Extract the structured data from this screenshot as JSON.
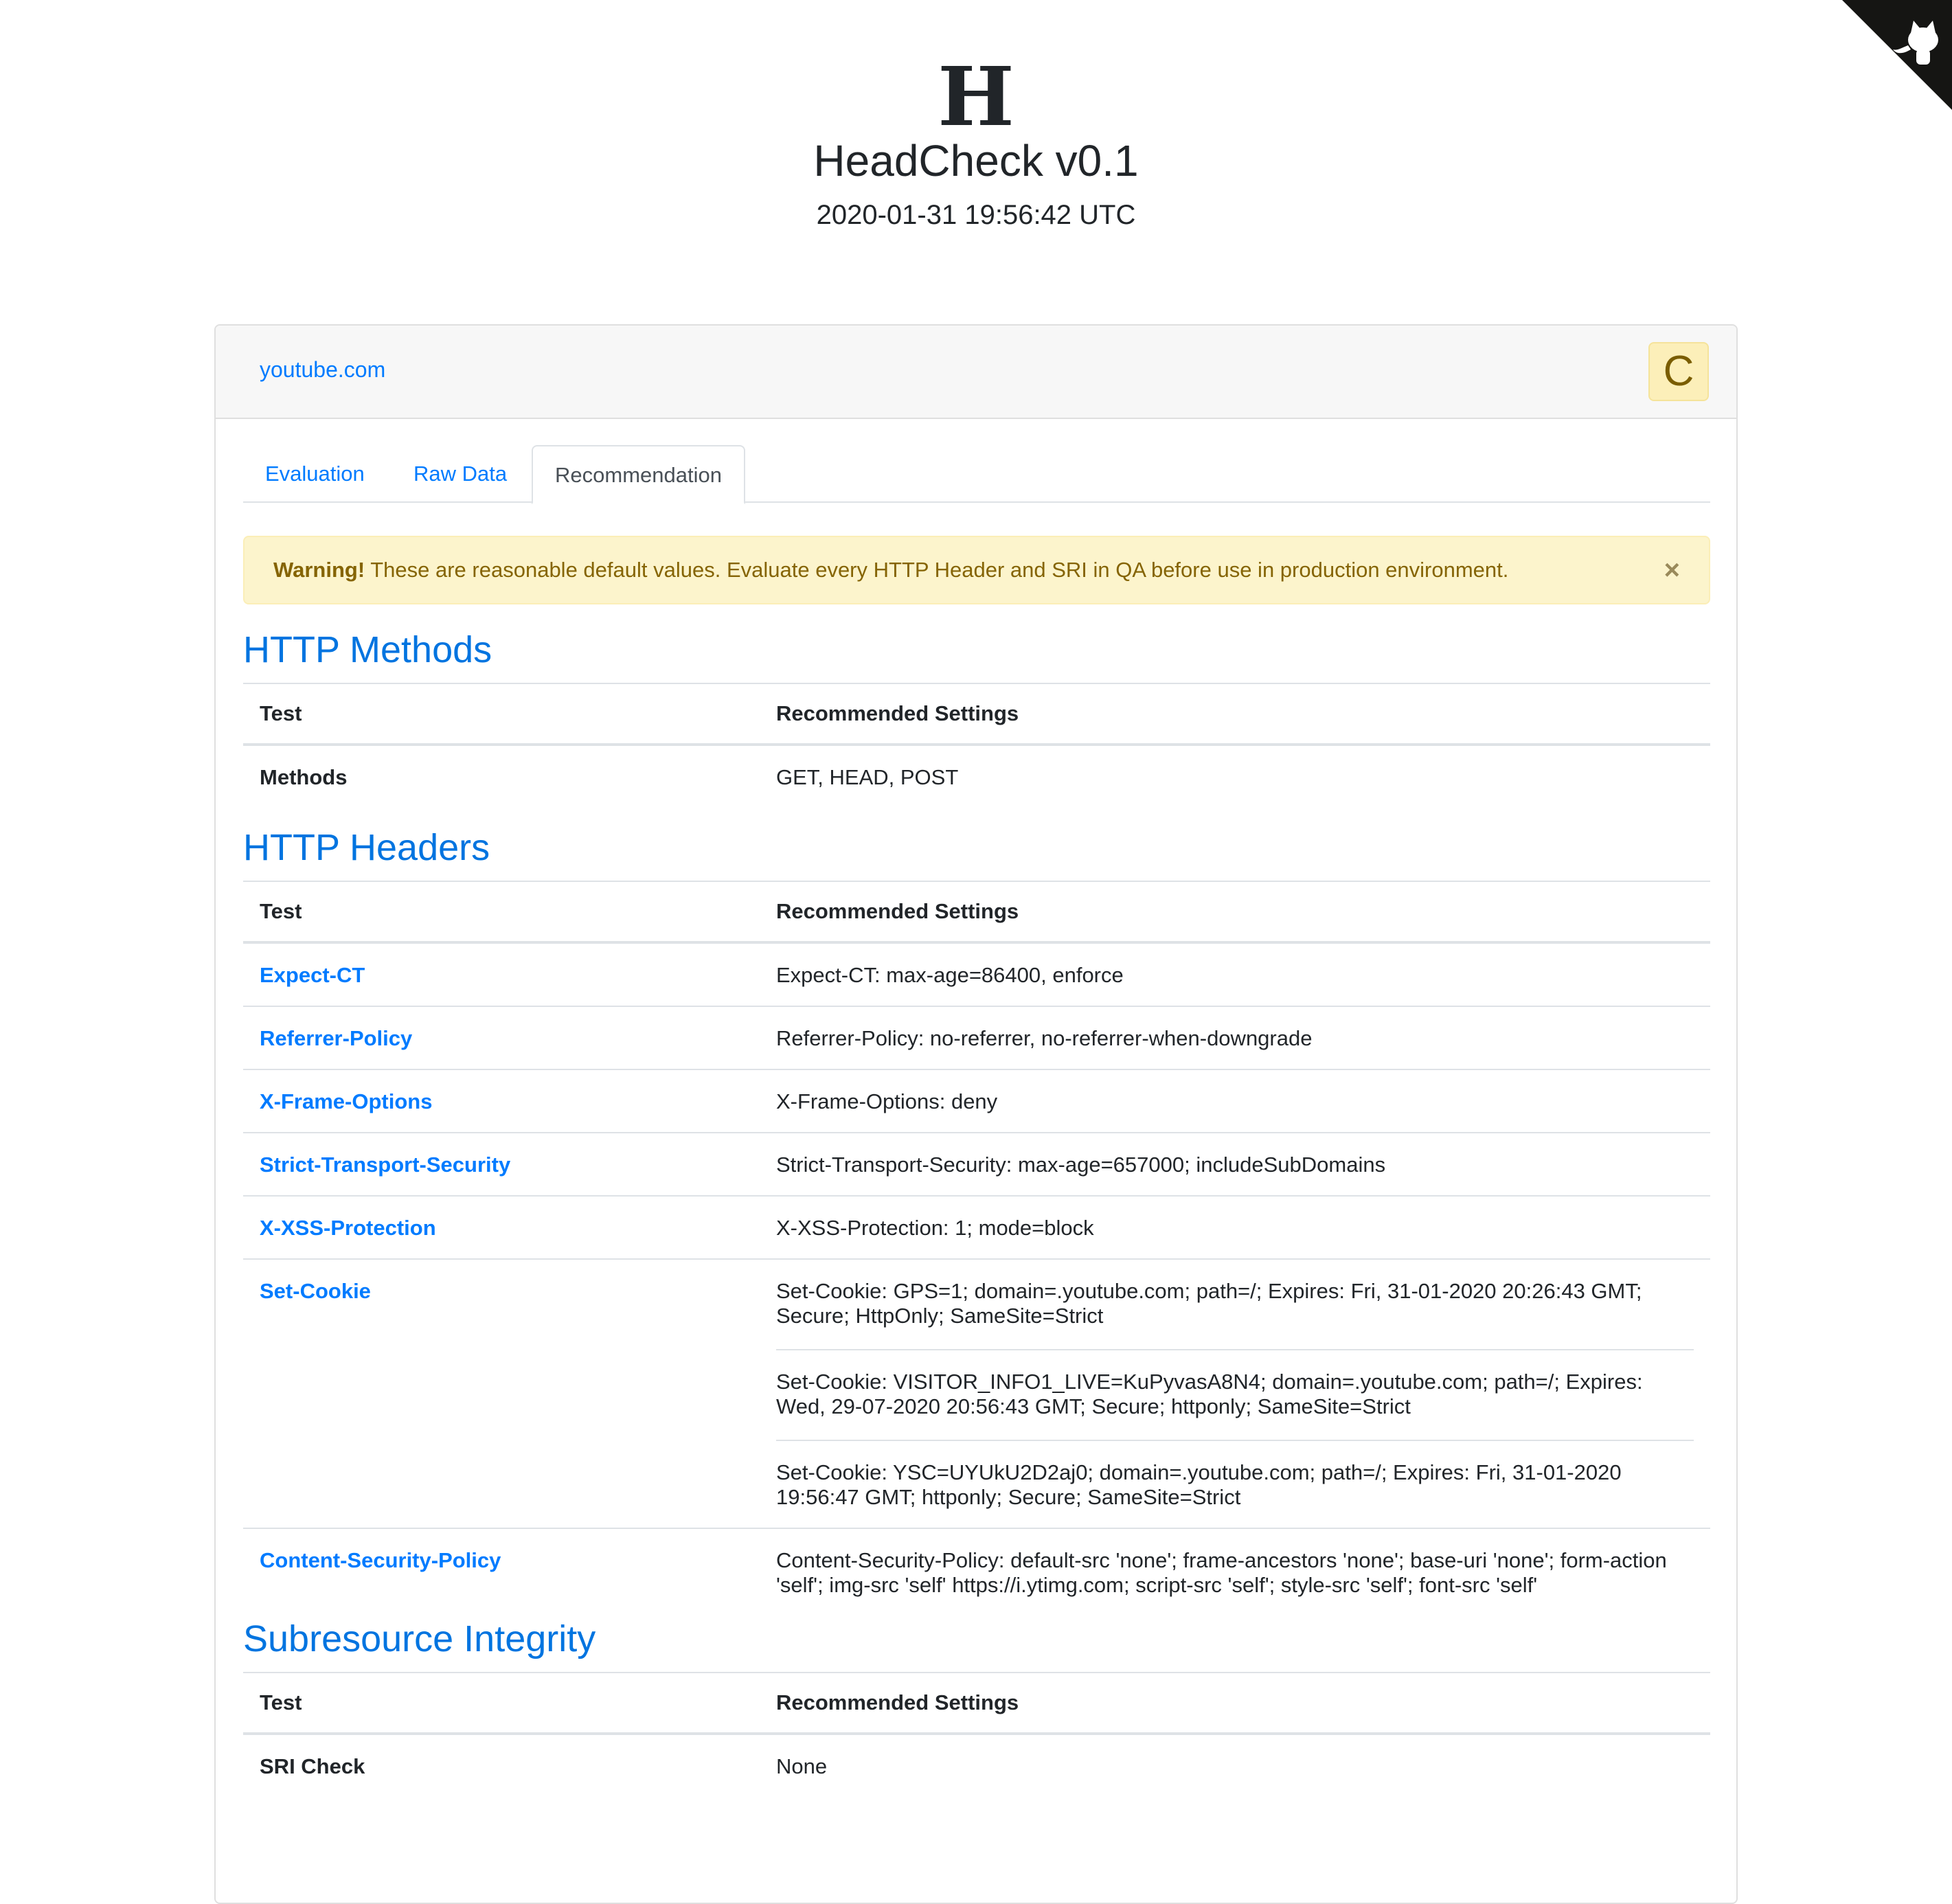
{
  "header": {
    "logo": "H",
    "app_title": "HeadCheck v0.1",
    "timestamp": "2020-01-31 19:56:42 UTC"
  },
  "corner_icon": "github-octocat-icon",
  "card": {
    "domain": "youtube.com",
    "grade": "C",
    "grade_color": "#7a5d00",
    "tabs": [
      {
        "label": "Evaluation",
        "active": false
      },
      {
        "label": "Raw Data",
        "active": false
      },
      {
        "label": "Recommendation",
        "active": true
      }
    ],
    "alert": {
      "strong": "Warning!",
      "text": " These are reasonable default values. Evaluate every HTTP Header and SRI in QA before use in production environment.",
      "close": "×"
    }
  },
  "colors": {
    "accent": "#007bff",
    "warning_bg": "#fcf4cc",
    "warning_text": "#856404"
  },
  "sections": {
    "methods": {
      "title": "HTTP Methods",
      "headers": [
        "Test",
        "Recommended Settings"
      ],
      "rows": [
        {
          "test": "Methods",
          "value": "GET, HEAD, POST"
        }
      ]
    },
    "headers": {
      "title": "HTTP Headers",
      "headers": [
        "Test",
        "Recommended Settings"
      ],
      "rows": [
        {
          "test": "Expect-CT",
          "value": "Expect-CT: max-age=86400, enforce"
        },
        {
          "test": "Referrer-Policy",
          "value": "Referrer-Policy: no-referrer, no-referrer-when-downgrade"
        },
        {
          "test": "X-Frame-Options",
          "value": "X-Frame-Options: deny"
        },
        {
          "test": "Strict-Transport-Security",
          "value": "Strict-Transport-Security: max-age=657000; includeSubDomains"
        },
        {
          "test": "X-XSS-Protection",
          "value": "X-XSS-Protection: 1; mode=block"
        },
        {
          "test": "Set-Cookie",
          "values": [
            "Set-Cookie: GPS=1; domain=.youtube.com; path=/; Expires: Fri, 31-01-2020 20:26:43 GMT; Secure; HttpOnly; SameSite=Strict",
            "Set-Cookie: VISITOR_INFO1_LIVE=KuPyvasA8N4; domain=.youtube.com; path=/; Expires: Wed, 29-07-2020 20:56:43 GMT; Secure; httponly; SameSite=Strict",
            "Set-Cookie: YSC=UYUkU2D2aj0; domain=.youtube.com; path=/; Expires: Fri, 31-01-2020 19:56:47 GMT; httponly; Secure; SameSite=Strict"
          ]
        },
        {
          "test": "Content-Security-Policy",
          "value": "Content-Security-Policy: default-src 'none'; frame-ancestors 'none'; base-uri 'none'; form-action 'self'; img-src 'self' https://i.ytimg.com; script-src 'self'; style-src 'self'; font-src 'self'"
        }
      ]
    },
    "sri": {
      "title": "Subresource Integrity",
      "headers": [
        "Test",
        "Recommended Settings"
      ],
      "rows": [
        {
          "test": "SRI Check",
          "value": "None"
        }
      ]
    }
  }
}
